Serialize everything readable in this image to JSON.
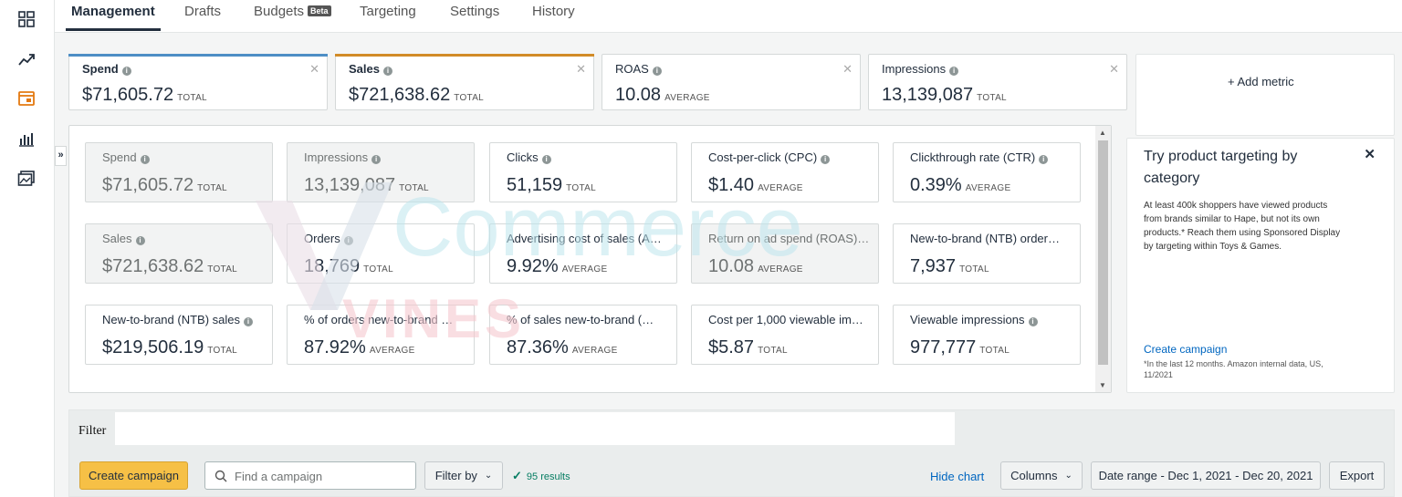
{
  "tabs": [
    {
      "label": "Management",
      "active": true
    },
    {
      "label": "Drafts"
    },
    {
      "label": "Budgets",
      "badge": "Beta"
    },
    {
      "label": "Targeting"
    },
    {
      "label": "Settings"
    },
    {
      "label": "History"
    }
  ],
  "left_rail_icons": [
    "dashboard-icon",
    "trend-icon",
    "campaign-icon",
    "reports-icon",
    "media-icon"
  ],
  "metric_tiles": [
    {
      "label": "Spend",
      "value": "$71,605.72",
      "agg": "TOTAL",
      "color": "#4d8ec5"
    },
    {
      "label": "Sales",
      "value": "$721,638.62",
      "agg": "TOTAL",
      "color": "#d28b27"
    },
    {
      "label": "ROAS",
      "value": "10.08",
      "agg": "AVERAGE"
    },
    {
      "label": "Impressions",
      "value": "13,139,087",
      "agg": "TOTAL"
    }
  ],
  "add_metric_label": "+ Add metric",
  "cards": [
    {
      "label": "Spend",
      "value": "$71,605.72",
      "agg": "TOTAL",
      "selected": true,
      "info": true
    },
    {
      "label": "Impressions",
      "value": "13,139,087",
      "agg": "TOTAL",
      "selected": true,
      "info": true
    },
    {
      "label": "Clicks",
      "value": "51,159",
      "agg": "TOTAL",
      "info": true
    },
    {
      "label": "Cost-per-click (CPC)",
      "value": "$1.40",
      "agg": "AVERAGE",
      "info": true
    },
    {
      "label": "Clickthrough rate (CTR)",
      "value": "0.39%",
      "agg": "AVERAGE",
      "info": true
    },
    {
      "label": "Sales",
      "value": "$721,638.62",
      "agg": "TOTAL",
      "selected": true,
      "info": true
    },
    {
      "label": "Orders",
      "value": "18,769",
      "agg": "TOTAL",
      "info": true
    },
    {
      "label": "Advertising cost of sales (A…",
      "value": "9.92%",
      "agg": "AVERAGE"
    },
    {
      "label": "Return on ad spend (ROAS)…",
      "value": "10.08",
      "agg": "AVERAGE",
      "selected": true
    },
    {
      "label": "New-to-brand (NTB) order…",
      "value": "7,937",
      "agg": "TOTAL"
    },
    {
      "label": "New-to-brand (NTB) sales",
      "value": "$219,506.19",
      "agg": "TOTAL",
      "info": true
    },
    {
      "label": "% of orders new-to-brand …",
      "value": "87.92%",
      "agg": "AVERAGE"
    },
    {
      "label": "% of sales new-to-brand (…",
      "value": "87.36%",
      "agg": "AVERAGE"
    },
    {
      "label": "Cost per 1,000 viewable im…",
      "value": "$5.87",
      "agg": "TOTAL"
    },
    {
      "label": "Viewable impressions",
      "value": "977,777",
      "agg": "TOTAL",
      "info": true
    }
  ],
  "promo": {
    "title": "Try product targeting by category",
    "body": "At least 400k shoppers have viewed products from brands similar to Hape, but not its own products.* Reach them using Sponsored Display by targeting within Toys & Games.",
    "link": "Create campaign",
    "footnote": "*In the last 12 months. Amazon internal data, US, 11/2021"
  },
  "watermark": {
    "text1": "Commerce",
    "text2": "VINES"
  },
  "filter": {
    "label": "Filter"
  },
  "toolbar": {
    "create_campaign": "Create campaign",
    "search_placeholder": "Find a campaign",
    "filter_by": "Filter by",
    "results": "95 results",
    "hide_chart": "Hide chart",
    "columns": "Columns",
    "date_range": "Date range - Dec 1, 2021 - Dec 20, 2021",
    "export": "Export"
  }
}
